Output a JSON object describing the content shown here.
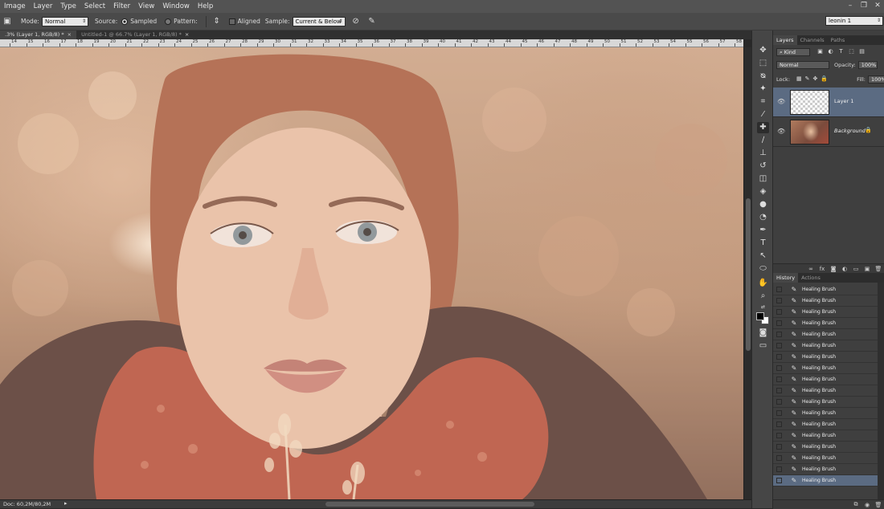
{
  "menu": [
    "Image",
    "Layer",
    "Type",
    "Select",
    "Filter",
    "View",
    "Window",
    "Help"
  ],
  "window_controls": [
    "–",
    "❐",
    "✕"
  ],
  "options": {
    "mode_label": "Mode:",
    "mode_value": "Normal",
    "source_label": "Source:",
    "sampled_label": "Sampled",
    "pattern_label": "Pattern:",
    "aligned_label": "Aligned",
    "sample_label": "Sample:",
    "sample_value": "Current & Below",
    "workspace": "leonin 1"
  },
  "tabs": [
    {
      "label": ".3% (Layer 1, RGB/8) *",
      "close": "×"
    },
    {
      "label": "Untitled-1 @ 66.7% (Layer 1, RGB/8) *",
      "close": "×"
    }
  ],
  "ruler": [
    "14",
    "15",
    "16",
    "17",
    "18",
    "19",
    "20",
    "21",
    "22",
    "23",
    "24",
    "25",
    "26",
    "27",
    "28",
    "29",
    "30",
    "31",
    "32",
    "33",
    "34",
    "35",
    "36",
    "37",
    "38",
    "39",
    "40",
    "41",
    "42",
    "43",
    "44",
    "45",
    "46",
    "47",
    "48",
    "49",
    "50",
    "51",
    "52",
    "53",
    "54",
    "55",
    "56",
    "57",
    "58"
  ],
  "status": {
    "doc": "Doc: 60,2M/80,2M",
    "arrow": "▸"
  },
  "layers_panel": {
    "tabs": [
      "Layers",
      "Channels",
      "Paths"
    ],
    "kind": "Kind",
    "blend": "Normal",
    "opacity_label": "Opacity:",
    "opacity_value": "100%",
    "lock_label": "Lock:",
    "fill_label": "Fill:",
    "fill_value": "100%",
    "layers": [
      {
        "name": "Layer 1"
      },
      {
        "name": "Background",
        "lock": "🔒"
      }
    ]
  },
  "history_panel": {
    "tabs": [
      "History",
      "Actions"
    ],
    "items": [
      "Healing Brush",
      "Healing Brush",
      "Healing Brush",
      "Healing Brush",
      "Healing Brush",
      "Healing Brush",
      "Healing Brush",
      "Healing Brush",
      "Healing Brush",
      "Healing Brush",
      "Healing Brush",
      "Healing Brush",
      "Healing Brush",
      "Healing Brush",
      "Healing Brush",
      "Healing Brush",
      "Healing Brush",
      "Healing Brush"
    ]
  }
}
